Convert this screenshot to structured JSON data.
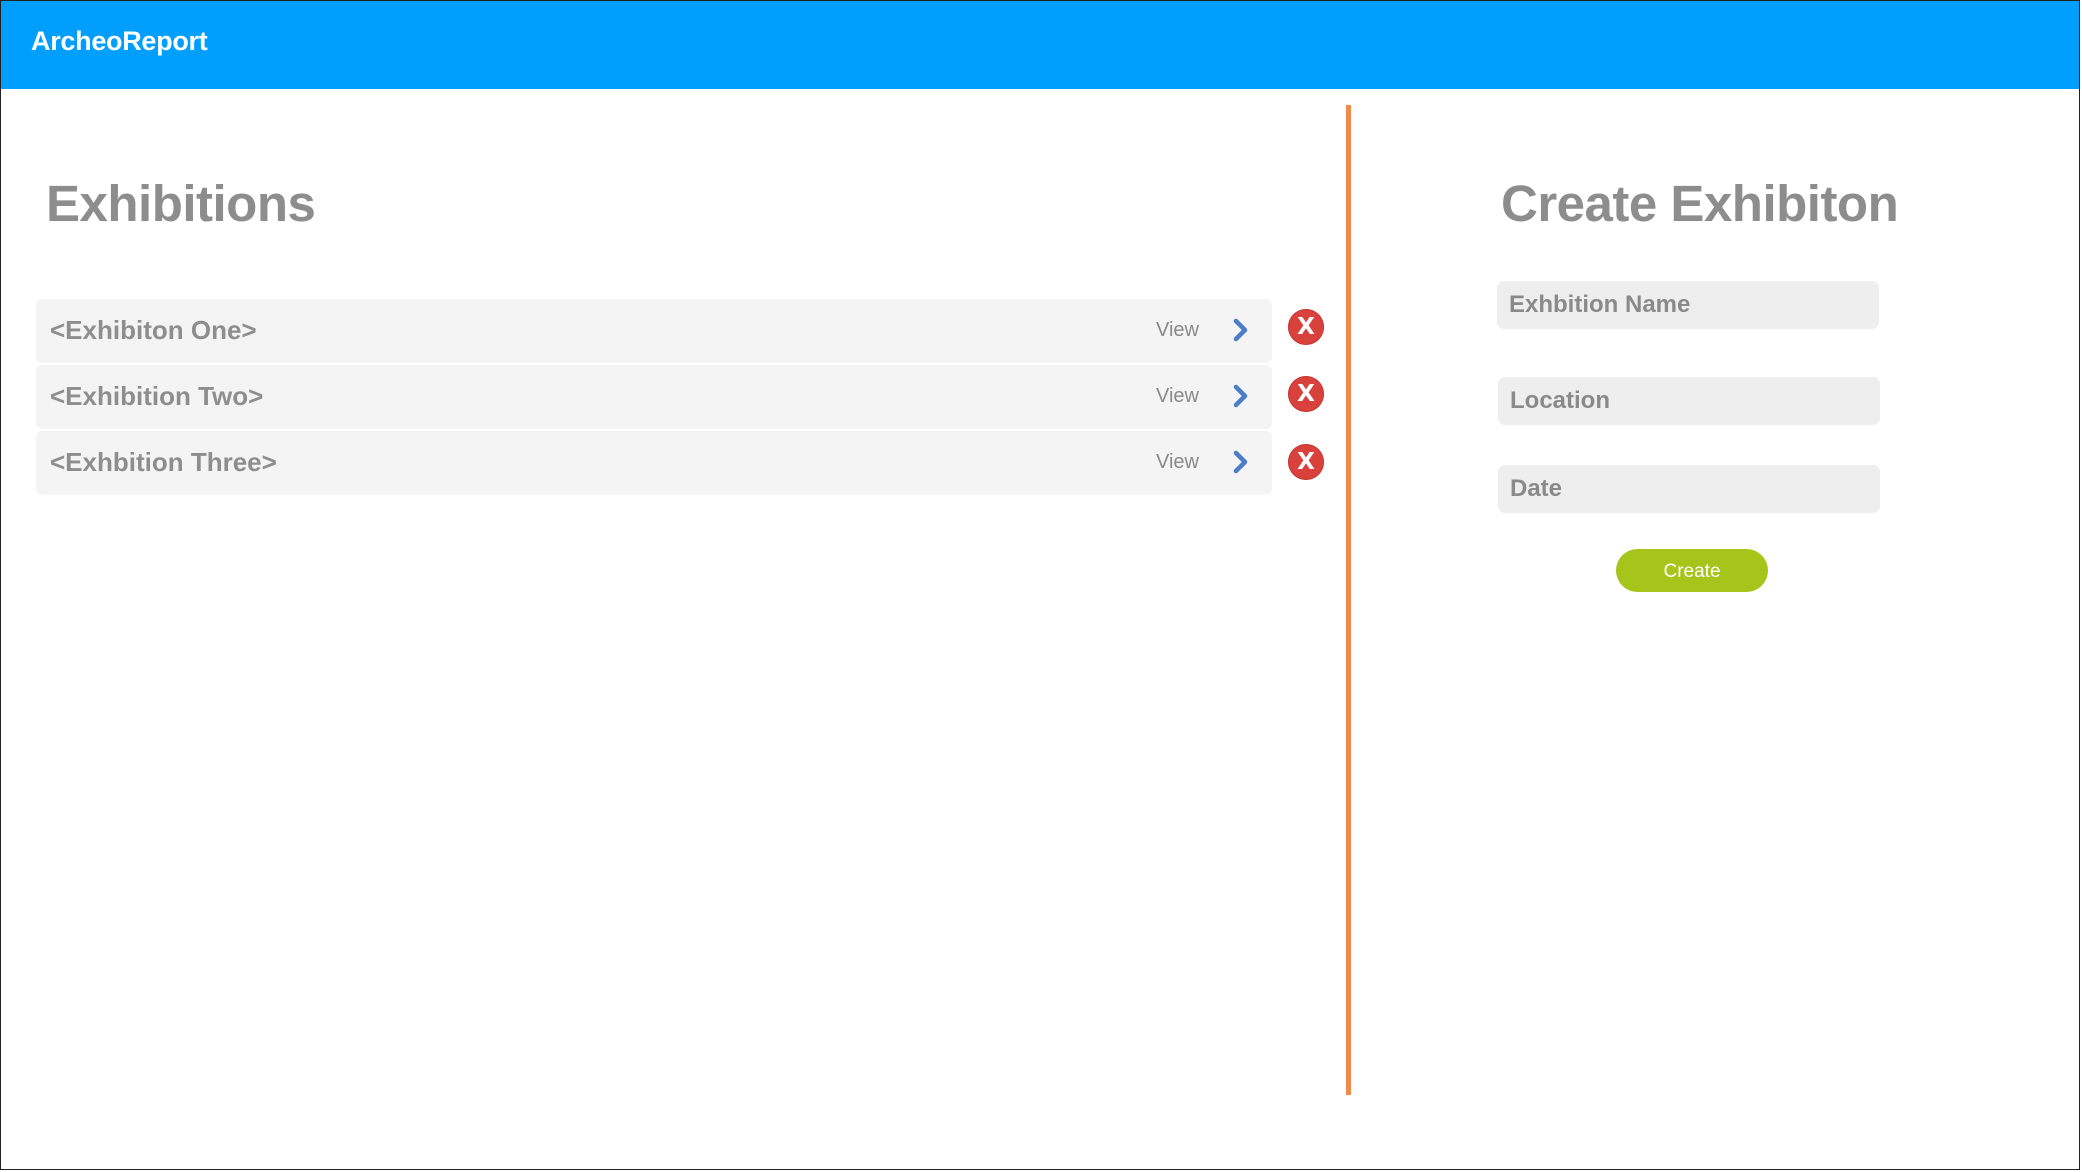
{
  "app": {
    "brand": "ArcheoReport",
    "colors": {
      "header": "#009ffd",
      "divider": "#f0894e",
      "delete": "#d9423c",
      "create": "#a6c51a",
      "chevron": "#4a7ec9"
    }
  },
  "exhibitions": {
    "title": "Exhibitions",
    "items": [
      {
        "name": "<Exhibiton One>",
        "view_label": "View",
        "chevron_icon": "chevron-right-icon",
        "delete_label": "X"
      },
      {
        "name": "<Exhibition Two>",
        "view_label": "View",
        "chevron_icon": "chevron-right-icon",
        "delete_label": "X"
      },
      {
        "name": "<Exhbition Three>",
        "view_label": "View",
        "chevron_icon": "chevron-right-icon",
        "delete_label": "X"
      }
    ]
  },
  "create_form": {
    "title": "Create Exhibiton",
    "fields": {
      "name": {
        "placeholder": "Exhbition Name",
        "value": ""
      },
      "location": {
        "placeholder": "Location",
        "value": ""
      },
      "date": {
        "placeholder": "Date",
        "value": ""
      }
    },
    "submit_label": "Create"
  }
}
